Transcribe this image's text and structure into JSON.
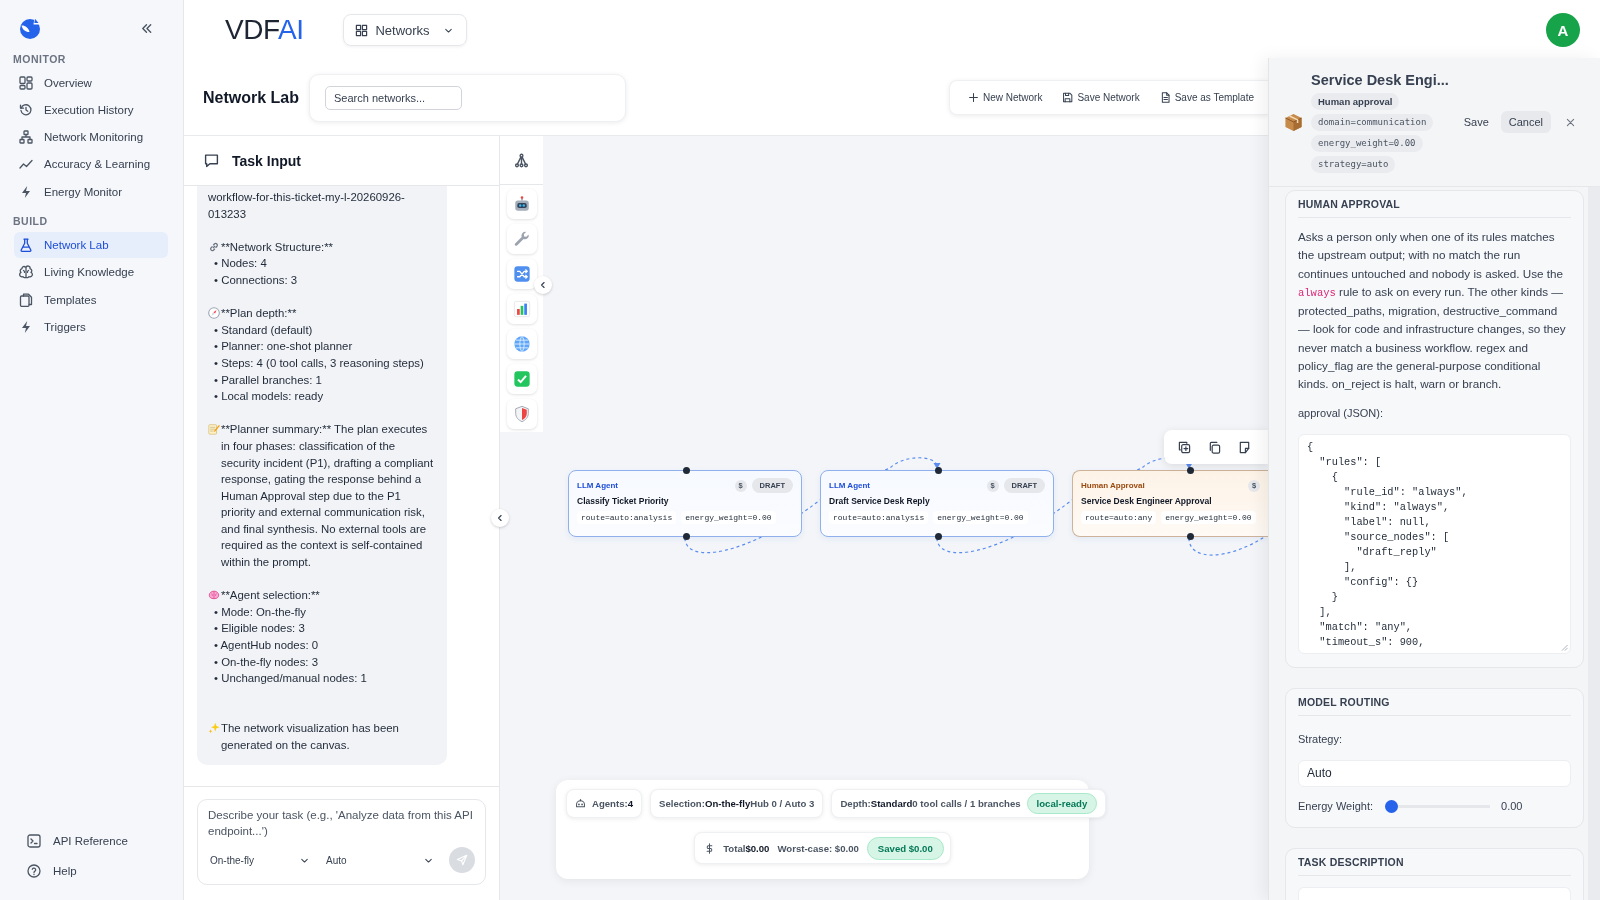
{
  "sidebar": {
    "sections": [
      {
        "title": "MONITOR",
        "items": [
          {
            "label": "Overview",
            "selected": false
          },
          {
            "label": "Execution History",
            "selected": false
          },
          {
            "label": "Network Monitoring",
            "selected": false
          },
          {
            "label": "Accuracy & Learning",
            "selected": false
          },
          {
            "label": "Energy Monitor",
            "selected": false
          }
        ]
      },
      {
        "title": "BUILD",
        "items": [
          {
            "label": "Network Lab",
            "selected": true
          },
          {
            "label": "Living Knowledge",
            "selected": false
          },
          {
            "label": "Templates",
            "selected": false
          },
          {
            "label": "Triggers",
            "selected": false
          }
        ]
      }
    ],
    "footer": [
      "API Reference",
      "Help"
    ]
  },
  "header": {
    "logo": {
      "text": "VDF",
      "accent": "AI"
    },
    "switcher": "Networks",
    "avatar": "A"
  },
  "page": {
    "title": "Network Lab",
    "search": {
      "placeholder": "Search networks..."
    },
    "actions": [
      "New Network",
      "Save Network",
      "Save as Template"
    ]
  },
  "task_panel": {
    "title": "Task Input",
    "message": [
      {
        "kind": "text",
        "text": "workflow-for-this-ticket-my-l-20260926-013233"
      },
      {
        "kind": "structure",
        "text": "**Network Structure:**",
        "items": [
          "• Nodes: 4",
          "• Connections: 3"
        ]
      },
      {
        "kind": "depth",
        "text": "**Plan depth:**",
        "items": [
          "• Standard (default)",
          "• Planner: one-shot planner",
          "• Steps: 4 (0 tool calls, 3 reasoning steps)",
          "• Parallel branches: 1",
          "• Local models: ready"
        ]
      },
      {
        "kind": "summary",
        "text": "**Planner summary:** The plan executes in four phases: classification of the security incident (P1), drafting a compliant response, gating the response behind a Human Approval step due to the P1 priority and external communication risk, and final synthesis. No external tools are required as the context is self-contained within the prompt."
      },
      {
        "kind": "selection",
        "text": "**Agent selection:**",
        "items": [
          "• Mode: On-the-fly",
          "• Eligible nodes: 3",
          "• AgentHub nodes: 0",
          "• On-the-fly nodes: 3",
          "• Unchanged/manual nodes: 1"
        ]
      },
      {
        "kind": "done",
        "text": "The network visualization has been generated on the canvas."
      }
    ],
    "input": {
      "placeholder": "Describe your task (e.g., 'Analyze data from this API endpoint...')",
      "mode": "On-the-fly",
      "model": "Auto",
      "send_disabled": true
    }
  },
  "canvas": {
    "nodes": [
      {
        "kind": "llm",
        "type": "LLM Agent",
        "cost": "$",
        "status": "DRAFT",
        "title": "Classify Ticket Priority",
        "tags": [
          "route=auto:analysis",
          "energy_weight=0.00"
        ]
      },
      {
        "kind": "llm",
        "type": "LLM Agent",
        "cost": "$",
        "status": "DRAFT",
        "title": "Draft Service Desk Reply",
        "tags": [
          "route=auto:analysis",
          "energy_weight=0.00"
        ]
      },
      {
        "kind": "approval",
        "type": "Human Approval",
        "cost": "$",
        "title": "Service Desk Engineer Approval",
        "tags": [
          "route=auto:any",
          "energy_weight=0.00"
        ]
      }
    ],
    "stats": {
      "agents": "Agents:**4**",
      "selection": "Selection:**On-the-fly**Hub 0 / Auto 3",
      "depth": "Depth:**Standard**0 tool calls / 1 branches",
      "depth_badge": "local-ready",
      "total": "Total**$0.00**",
      "worst_case": "Worst-case: $0.00",
      "saved": "Saved $0.00"
    }
  },
  "inspector": {
    "title": "Service Desk Engi...",
    "tags": [
      {
        "kind": "type",
        "text": "Human approval"
      },
      {
        "kind": "mono",
        "text": "domain=communication"
      },
      {
        "kind": "mono",
        "text": "energy_weight=0.00"
      },
      {
        "kind": "mono",
        "text": "strategy=auto"
      }
    ],
    "save": "Save",
    "cancel": "Cancel",
    "sections": [
      {
        "kind": "approval",
        "heading": "HUMAN APPROVAL",
        "description": [
          {
            "kind": "text",
            "text": "Asks a person only when one of its rules matches the upstream output; with no match the run continues untouched and nobody is asked. Use the "
          },
          {
            "kind": "code",
            "text": "always"
          },
          {
            "kind": "text",
            "text": " rule to ask on every run. The other kinds — protected_paths, migration, destructive_command — look for code and infrastructure changes, so they never match a business workflow. regex and policy_flag are the general-purpose conditional kinds. on_reject is halt, warn or branch."
          }
        ],
        "field_label": "approval (JSON):",
        "value": "{\n  \"rules\": [\n    {\n      \"rule_id\": \"always\",\n      \"kind\": \"always\",\n      \"label\": null,\n      \"source_nodes\": [\n        \"draft_reply\"\n      ],\n      \"config\": {}\n    }\n  ],\n  \"match\": \"any\",\n  \"timeout_s\": 900,"
      },
      {
        "kind": "routing",
        "heading": "MODEL ROUTING",
        "strategy_label": "Strategy:",
        "strategy": "Auto",
        "weight_label": "Energy Weight:",
        "weight": {
          "level": 0,
          "reading": "0.00"
        }
      },
      {
        "kind": "task",
        "heading": "TASK DESCRIPTION"
      }
    ]
  }
}
